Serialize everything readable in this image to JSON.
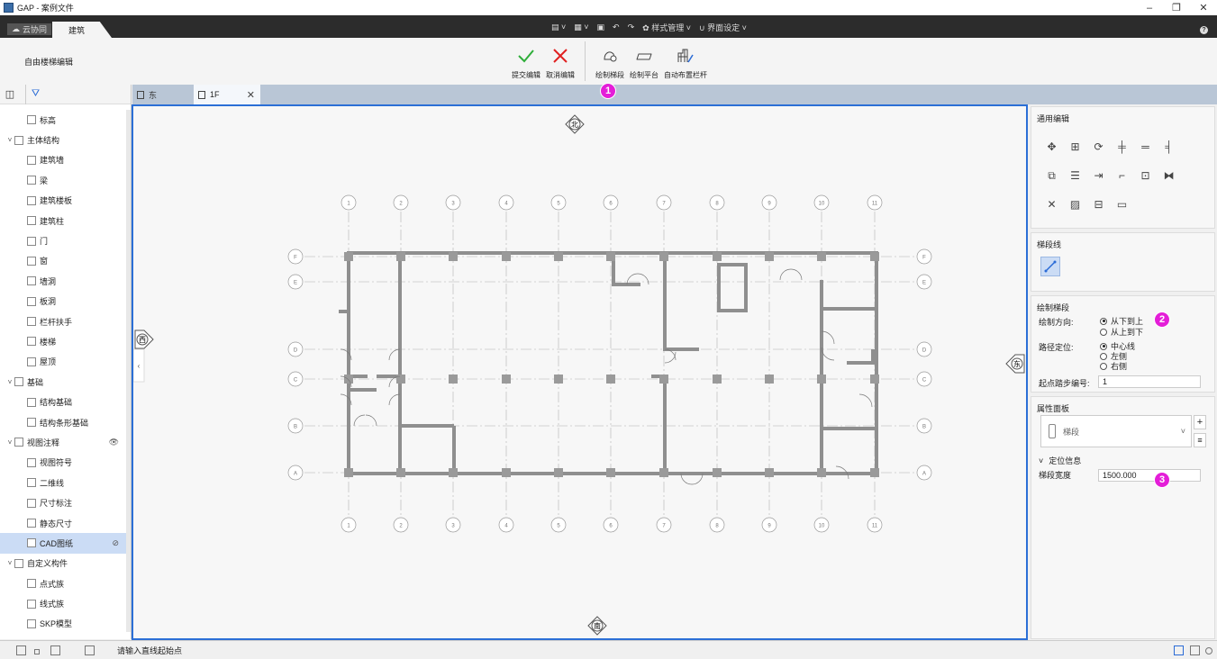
{
  "app": {
    "title": "GAP - 案例文件"
  },
  "window_controls": [
    "–",
    "❐",
    "✕"
  ],
  "ribbon_tabs": {
    "cloud": "云协同",
    "active": "建筑"
  },
  "quick_access": {
    "style_mgmt": "样式管理",
    "ui_settings": "界面设定"
  },
  "ribbon": {
    "mode_label": "自由楼梯编辑",
    "buttons": [
      {
        "label": "提交编辑",
        "icon": "check-icon"
      },
      {
        "label": "取消编辑",
        "icon": "x-icon"
      },
      {
        "label": "绘制梯段",
        "icon": "draw-stair-icon"
      },
      {
        "label": "绘制平台",
        "icon": "draw-platform-icon"
      },
      {
        "label": "自动布置栏杆",
        "icon": "railing-icon"
      }
    ]
  },
  "doc_tabs": [
    {
      "label": "东"
    },
    {
      "label": "1F",
      "close": "✕"
    }
  ],
  "tree": [
    {
      "label": "标高",
      "level": 2
    },
    {
      "label": "主体结构",
      "level": 1,
      "expanded": true
    },
    {
      "label": "建筑墙",
      "level": 2
    },
    {
      "label": "梁",
      "level": 2
    },
    {
      "label": "建筑楼板",
      "level": 2
    },
    {
      "label": "建筑柱",
      "level": 2
    },
    {
      "label": "门",
      "level": 2
    },
    {
      "label": "窗",
      "level": 2
    },
    {
      "label": "墙洞",
      "level": 2
    },
    {
      "label": "板洞",
      "level": 2
    },
    {
      "label": "栏杆扶手",
      "level": 2
    },
    {
      "label": "楼梯",
      "level": 2
    },
    {
      "label": "屋顶",
      "level": 2
    },
    {
      "label": "基础",
      "level": 1,
      "expanded": true
    },
    {
      "label": "结构基础",
      "level": 2
    },
    {
      "label": "结构条形基础",
      "level": 2
    },
    {
      "label": "视图注释",
      "level": 1,
      "expanded": true,
      "eye": "👁"
    },
    {
      "label": "视图符号",
      "level": 2
    },
    {
      "label": "二维线",
      "level": 2
    },
    {
      "label": "尺寸标注",
      "level": 2
    },
    {
      "label": "静态尺寸",
      "level": 2
    },
    {
      "label": "CAD图纸",
      "level": 2,
      "selected": true,
      "eye": "⊘"
    },
    {
      "label": "自定义构件",
      "level": 1,
      "expanded": true
    },
    {
      "label": "点式族",
      "level": 2
    },
    {
      "label": "线式族",
      "level": 2
    },
    {
      "label": "SKP模型",
      "level": 2
    }
  ],
  "compass": {
    "north": "北",
    "south": "南",
    "west": "西",
    "east": "东"
  },
  "grid": {
    "top_labels": [
      "1",
      "2",
      "3",
      "4",
      "5",
      "6",
      "7",
      "8",
      "9",
      "10",
      "11"
    ],
    "row_labels_left": [
      "F",
      "E",
      "D",
      "C",
      "B",
      "A"
    ],
    "row_labels_right": [
      "F",
      "E",
      "D",
      "C",
      "B",
      "A"
    ]
  },
  "right_panel": {
    "general_edit": {
      "title": "通用编辑"
    },
    "stair_line": {
      "title": "梯段线"
    },
    "draw_stair": {
      "title": "绘制梯段",
      "direction_label": "绘制方向:",
      "direction_options": [
        "从下到上",
        "从上到下"
      ],
      "direction_selected": 0,
      "path_label": "路径定位:",
      "path_options": [
        "中心线",
        "左侧",
        "右侧"
      ],
      "path_selected": 0,
      "start_step_label": "起点踏步编号:",
      "start_step_value": "1"
    },
    "properties": {
      "title": "属性面板",
      "type_value": "梯段",
      "section_title": "定位信息",
      "width_label": "梯段宽度",
      "width_value": "1500.000"
    }
  },
  "badges": [
    "1",
    "2",
    "3"
  ],
  "status": {
    "message": "请输入直线起始点"
  },
  "colors": {
    "accent": "#2b6fd6",
    "badge": "#e41ed8",
    "ribbon_dark": "#2c2c2c",
    "tab_strip": "#b9c6d6",
    "wall": "#8f8f8f"
  }
}
